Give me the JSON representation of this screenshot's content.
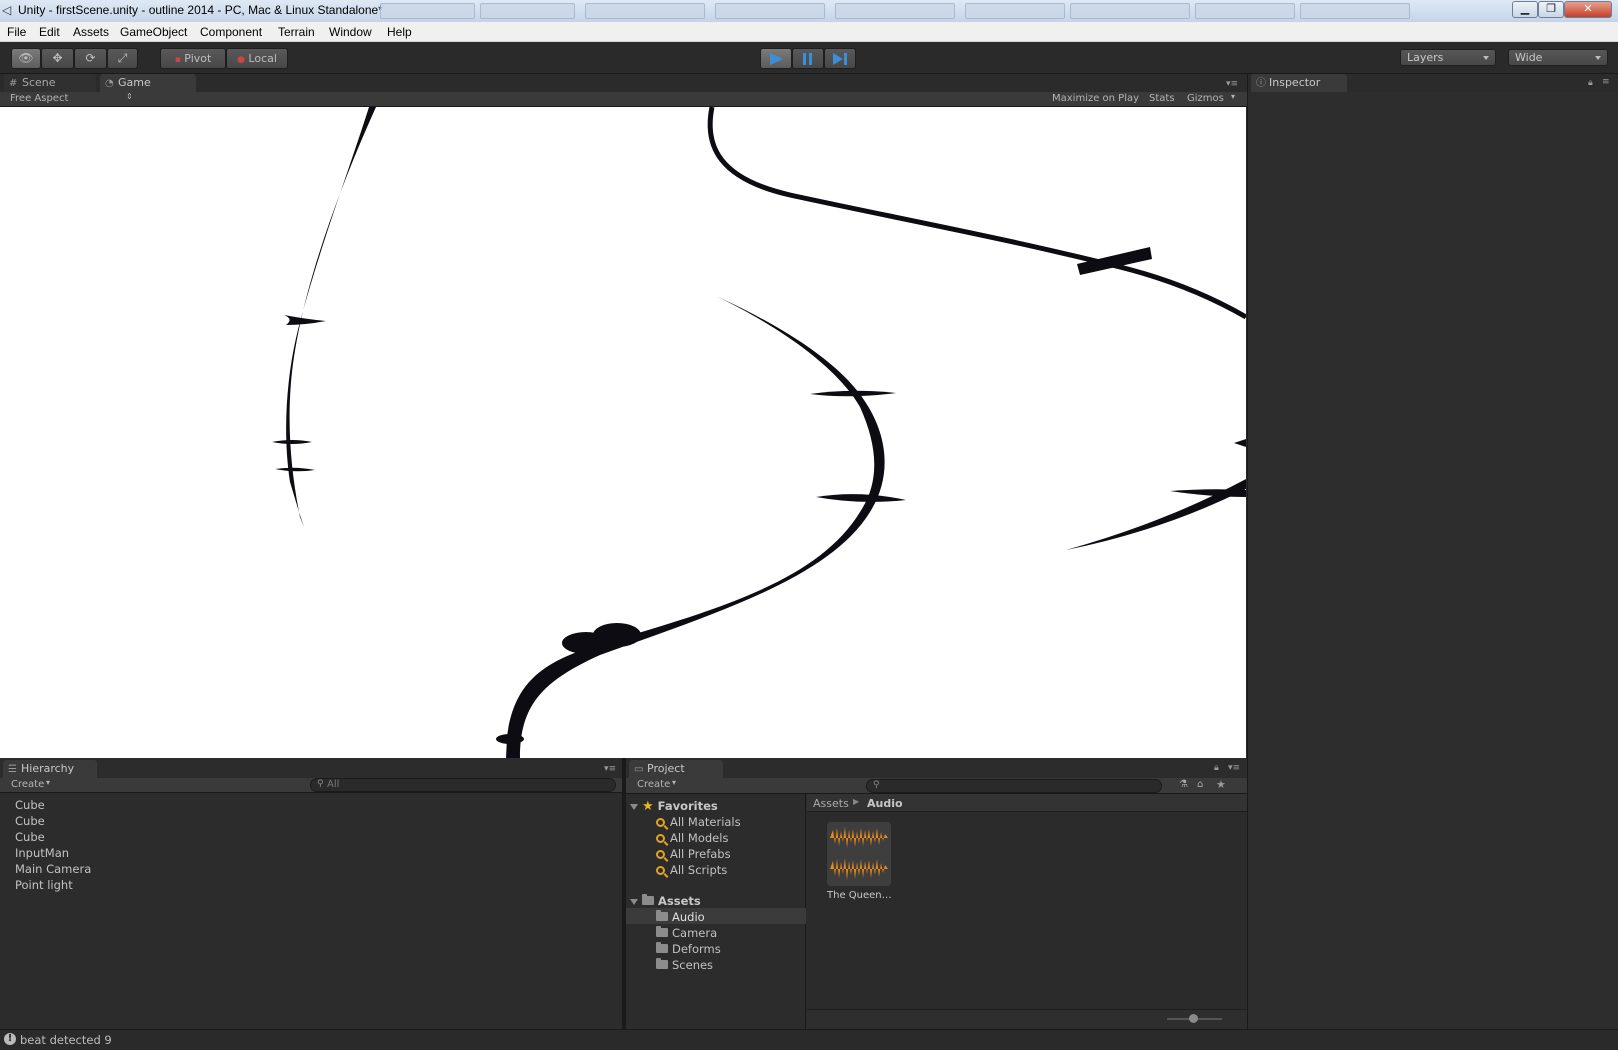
{
  "window": {
    "title": "Unity - firstScene.unity - outline 2014 - PC, Mac & Linux Standalone*",
    "minimize": "▁",
    "restore": "❐",
    "close": "✕"
  },
  "menu": [
    "File",
    "Edit",
    "Assets",
    "GameObject",
    "Component",
    "Terrain",
    "Window",
    "Help"
  ],
  "toolbar": {
    "pivot_label": "Pivot",
    "local_label": "Local",
    "layers_label": "Layers",
    "layout_label": "Wide"
  },
  "scene_view": {
    "tabs": [
      "Scene",
      "Game"
    ],
    "aspect_label": "Free Aspect",
    "maximize_label": "Maximize on Play",
    "stats_label": "Stats",
    "gizmos_label": "Gizmos"
  },
  "inspector": {
    "title": "Inspector"
  },
  "hierarchy": {
    "title": "Hierarchy",
    "create_label": "Create",
    "search_placeholder": "All",
    "items": [
      "Cube",
      "Cube",
      "Cube",
      "InputMan",
      "Main Camera",
      "Point light"
    ]
  },
  "project": {
    "title": "Project",
    "create_label": "Create",
    "favorites_label": "Favorites",
    "favorites": [
      "All Materials",
      "All Models",
      "All Prefabs",
      "All Scripts"
    ],
    "assets_label": "Assets",
    "folders": [
      "Audio",
      "Camera",
      "Deforms",
      "Scenes"
    ],
    "selected_folder": "Audio",
    "breadcrumb": [
      "Assets",
      "Audio"
    ],
    "asset_name": "The Queen…",
    "waveform_color": "#e8891a"
  },
  "status": {
    "message": "beat detected 9"
  },
  "colors": {
    "play_accent": "#3b8fd9",
    "favorites_star": "#e8b923",
    "editor_bg": "#2b2b2b"
  }
}
